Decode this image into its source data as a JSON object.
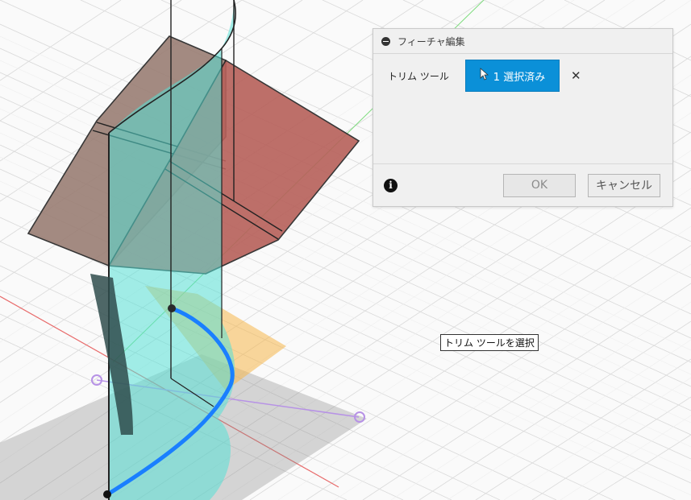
{
  "panel": {
    "title": "フィーチャ編集",
    "trim_tool_label": "トリム ツール",
    "selection_button_label": "1 選択済み",
    "clear_selection_icon": "close-icon",
    "ok_label": "OK",
    "cancel_label": "キャンセル",
    "info_icon": "info-icon"
  },
  "tooltip": {
    "text": "トリム ツールを選択"
  },
  "colors": {
    "accent": "#0b90d8",
    "surface_cyan": "#55e0d6",
    "surface_brown": "#9a7e74",
    "surface_red": "#b7605a",
    "spline_blue": "#1a7fff",
    "ground_gray": "#8c8c8c",
    "sketch_orange": "#f6b74a"
  }
}
